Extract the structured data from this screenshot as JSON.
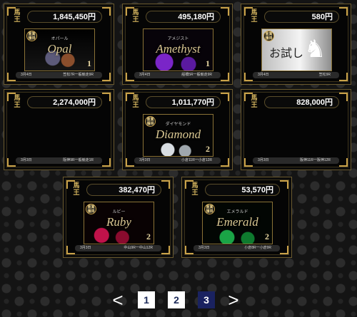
{
  "cards": [
    {
      "price": "1,845,450円",
      "gem": "Opal",
      "ruby": "オパール",
      "num": "1",
      "date": "3月4日",
      "race": "笠松7R一般競走9R",
      "badge": "重賞\n獲得",
      "style": "g-opal"
    },
    {
      "price": "495,180円",
      "gem": "Amethyst",
      "ruby": "アメジスト",
      "num": "1",
      "date": "3月4日",
      "race": "船橋5R一般競走9R",
      "badge": "",
      "style": "g-amethyst"
    },
    {
      "price": "580円",
      "gem": "お試し",
      "ruby": "",
      "num": "",
      "date": "3月4日",
      "race": "笠松9R",
      "badge": "重賞\n獲得",
      "style": "g-trial"
    },
    {
      "price": "2,274,000円",
      "gem": "",
      "ruby": "",
      "num": "",
      "date": "3月3日",
      "race": "阪神9R一般競走1R",
      "badge": "",
      "style": ""
    },
    {
      "price": "1,011,770円",
      "gem": "Diamond",
      "ruby": "ダイヤモンド",
      "num": "2",
      "date": "3月3日",
      "race": "小倉11R一小倉12R",
      "badge": "重賞\n獲得",
      "style": "g-diamond"
    },
    {
      "price": "828,000円",
      "gem": "",
      "ruby": "",
      "num": "",
      "date": "3月3日",
      "race": "阪神11R一阪神12R",
      "badge": "",
      "style": ""
    },
    {
      "price": "382,470円",
      "gem": "Ruby",
      "ruby": "ルビー",
      "num": "2",
      "date": "3月3日",
      "race": "中山9R一中山12R",
      "badge": "重賞\n獲得",
      "style": "g-ruby"
    },
    {
      "price": "53,570円",
      "gem": "Emerald",
      "ruby": "エメラルド",
      "num": "2",
      "date": "3月3日",
      "race": "小倉8R一小倉9R",
      "badge": "重賞\n獲得",
      "style": "g-emerald"
    }
  ],
  "emblem_text": "馬\n王",
  "pagination": {
    "prev": "<",
    "pages": [
      "1",
      "2",
      "3"
    ],
    "next": ">",
    "active": "3"
  }
}
